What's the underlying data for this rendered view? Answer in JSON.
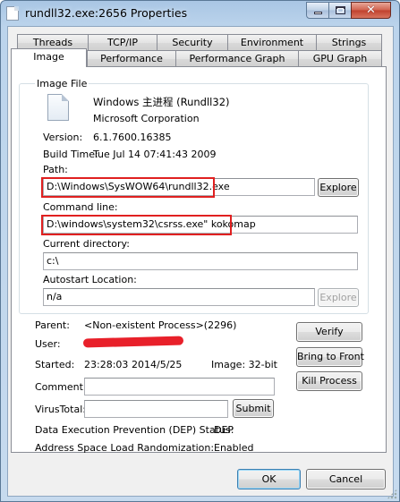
{
  "window": {
    "title": "rundll32.exe:2656 Properties"
  },
  "tabs": {
    "row1": [
      "Threads",
      "TCP/IP",
      "Security",
      "Environment",
      "Strings"
    ],
    "row2": [
      "Image",
      "Performance",
      "Performance Graph",
      "GPU Graph"
    ],
    "active": "Image"
  },
  "image_file": {
    "group_label": "Image File",
    "description": "Windows 主进程 (Rundll32)",
    "company": "Microsoft Corporation",
    "version_label": "Version:",
    "version": "6.1.7600.16385",
    "build_label": "Build Time:",
    "build_time": "Tue Jul 14 07:41:43 2009",
    "path_label": "Path:",
    "path": "D:\\Windows\\SysWOW64\\rundll32.exe",
    "explore_label": "Explore",
    "cmdline_label": "Command line:",
    "cmdline": "D:\\windows\\system32\\csrss.exe\" kokomap",
    "curdir_label": "Current directory:",
    "curdir": "c:\\",
    "autostart_label": "Autostart Location:",
    "autostart": "n/a",
    "explore2_label": "Explore"
  },
  "process": {
    "parent_label": "Parent:",
    "parent": "<Non-existent Process>(2296)",
    "user_label": "User:",
    "started_label": "Started:",
    "started_time": "23:28:03",
    "started_date": "2014/5/25",
    "image_bits": "Image: 32-bit",
    "comment_label": "Comment:",
    "comment": "",
    "virustotal_label": "VirusTotal:",
    "submit_label": "Submit",
    "dep_label": "Data Execution Prevention (DEP) Status:",
    "dep_value": "DEP",
    "aslr_label": "Address Space Load Randomization:",
    "aslr_value": "Enabled"
  },
  "actions": {
    "verify": "Verify",
    "bring_to_front": "Bring to Front",
    "kill_process": "Kill Process"
  },
  "footer": {
    "ok": "OK",
    "cancel": "Cancel"
  },
  "colors": {
    "highlight_box": "#e02020",
    "redaction": "#e8202a"
  }
}
